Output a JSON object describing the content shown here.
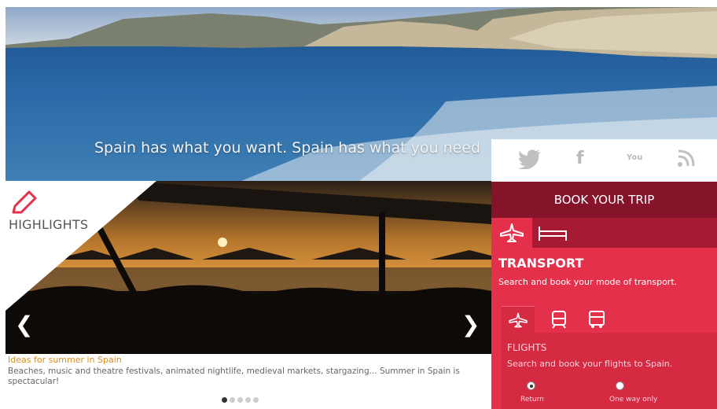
{
  "hero": {
    "tagline": "Spain has what you want. Spain has what you need"
  },
  "social": {
    "icons": [
      "twitter-icon",
      "facebook-icon",
      "youtube-icon",
      "rss-icon"
    ],
    "facebook_glyph": "f",
    "youtube_glyph": "You",
    "rss_glyph": "❩"
  },
  "highlights": {
    "label": "HIGHLIGHTS",
    "prev_glyph": "❮",
    "next_glyph": "❯",
    "caption_title": "Ideas for summer in Spain",
    "caption_text": "Beaches, music and theatre festivals, animated nightlife, medieval markets, stargazing... Summer in Spain is spectacular!",
    "slides_count": 5,
    "active_slide": 1
  },
  "booking": {
    "header": "BOOK YOUR TRIP",
    "modes": [
      "plane-icon",
      "bed-icon"
    ],
    "transport_title": "TRANSPORT",
    "transport_sub": "Search and book your mode of transport.",
    "sub_modes": [
      "plane-icon",
      "train-icon",
      "bus-icon"
    ],
    "flights_title": "FLIGHTS",
    "flights_sub": "Search and book your flights to Spain.",
    "trip_options": [
      {
        "label": "Return",
        "selected": true
      },
      {
        "label": "One way only",
        "selected": false
      }
    ]
  },
  "colors": {
    "accent": "#e4304a",
    "header": "#85142a",
    "caption": "#d98c1e"
  }
}
